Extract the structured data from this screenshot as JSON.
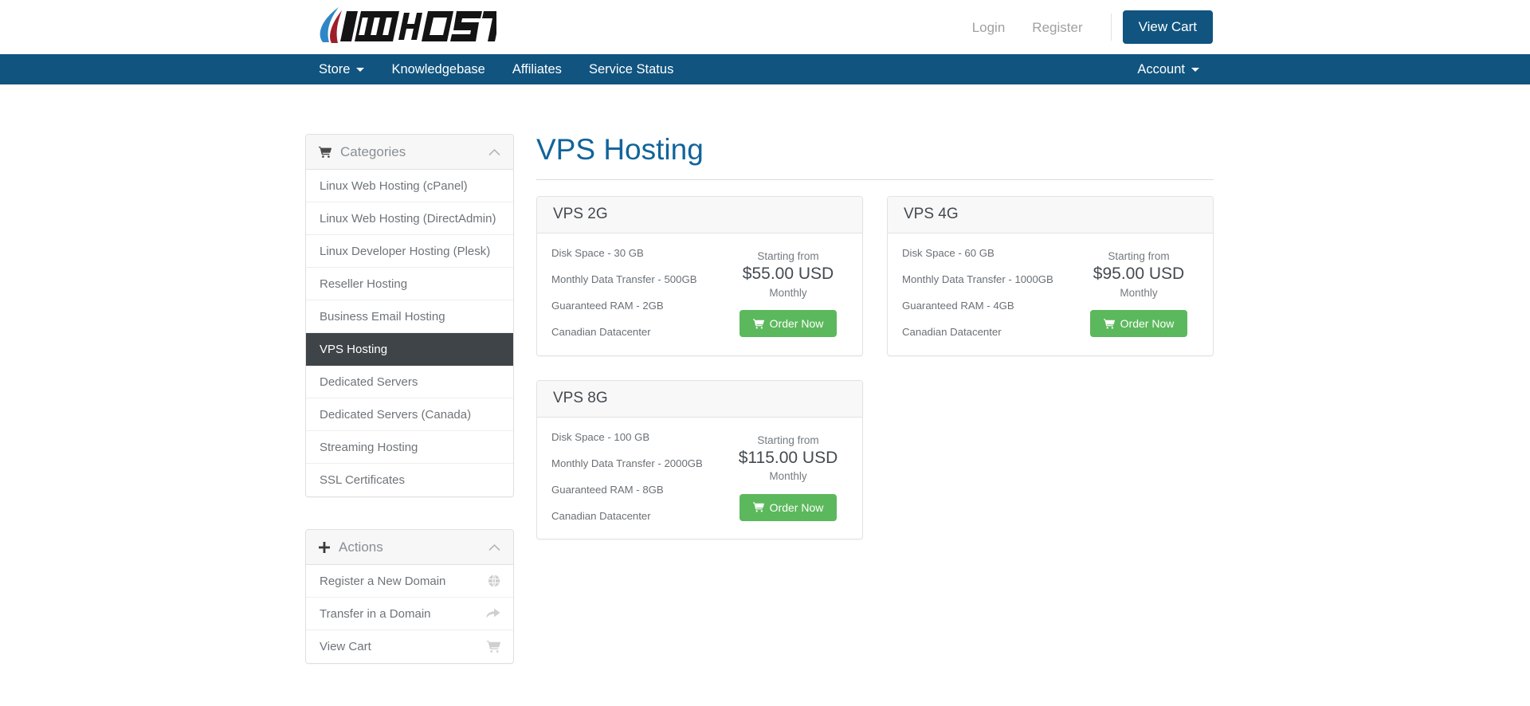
{
  "header": {
    "logo_text": "IMHOST",
    "links": [
      {
        "label": "Login",
        "name": "login-link"
      },
      {
        "label": "Register",
        "name": "register-link"
      }
    ],
    "view_cart_label": "View Cart"
  },
  "navbar": {
    "left_items": [
      {
        "label": "Store",
        "has_caret": true
      },
      {
        "label": "Knowledgebase",
        "has_caret": false
      },
      {
        "label": "Affiliates",
        "has_caret": false
      },
      {
        "label": "Service Status",
        "has_caret": false
      }
    ],
    "right_items": [
      {
        "label": "Account",
        "has_caret": true
      }
    ]
  },
  "sidebar": {
    "categories_panel": {
      "title": "Categories",
      "icon": "shopping-cart-icon",
      "collapse_icon": "chevron-up-icon",
      "items": [
        {
          "label": "Linux Web Hosting (cPanel)",
          "active": false
        },
        {
          "label": "Linux Web Hosting (DirectAdmin)",
          "active": false
        },
        {
          "label": "Linux Developer Hosting (Plesk)",
          "active": false
        },
        {
          "label": "Reseller Hosting",
          "active": false
        },
        {
          "label": "Business Email Hosting",
          "active": false
        },
        {
          "label": "VPS Hosting",
          "active": true
        },
        {
          "label": "Dedicated Servers",
          "active": false
        },
        {
          "label": "Dedicated Servers (Canada)",
          "active": false
        },
        {
          "label": "Streaming Hosting",
          "active": false
        },
        {
          "label": "SSL Certificates",
          "active": false
        }
      ]
    },
    "actions_panel": {
      "title": "Actions",
      "icon": "plus-icon",
      "collapse_icon": "chevron-up-icon",
      "items": [
        {
          "label": "Register a New Domain",
          "icon": "globe-icon"
        },
        {
          "label": "Transfer in a Domain",
          "icon": "share-arrow-icon"
        },
        {
          "label": "View Cart",
          "icon": "shopping-cart-icon"
        }
      ]
    }
  },
  "main": {
    "page_title": "VPS Hosting",
    "order_button_label": "Order Now",
    "products": [
      {
        "name": "VPS 2G",
        "features": [
          "Disk Space - 30 GB",
          "Monthly Data Transfer - 500GB",
          "Guaranteed RAM - 2GB",
          "Canadian Datacenter"
        ],
        "price_from_label": "Starting from",
        "price": "$55.00 USD",
        "billing_cycle": "Monthly"
      },
      {
        "name": "VPS 4G",
        "features": [
          "Disk Space - 60 GB",
          "Monthly Data Transfer - 1000GB",
          "Guaranteed RAM - 4GB",
          "Canadian Datacenter"
        ],
        "price_from_label": "Starting from",
        "price": "$95.00 USD",
        "billing_cycle": "Monthly"
      },
      {
        "name": "VPS 8G",
        "features": [
          "Disk Space - 100 GB",
          "Monthly Data Transfer - 2000GB",
          "Guaranteed RAM - 8GB",
          "Canadian Datacenter"
        ],
        "price_from_label": "Starting from",
        "price": "$115.00 USD",
        "billing_cycle": "Monthly"
      }
    ]
  },
  "colors": {
    "navbar_blue": "#10547f",
    "title_blue": "#11649b",
    "order_green": "#5cb85c",
    "active_item_dark": "#3f4448",
    "logo_blue": "#2f86c7",
    "logo_red": "#9e1f2a"
  }
}
